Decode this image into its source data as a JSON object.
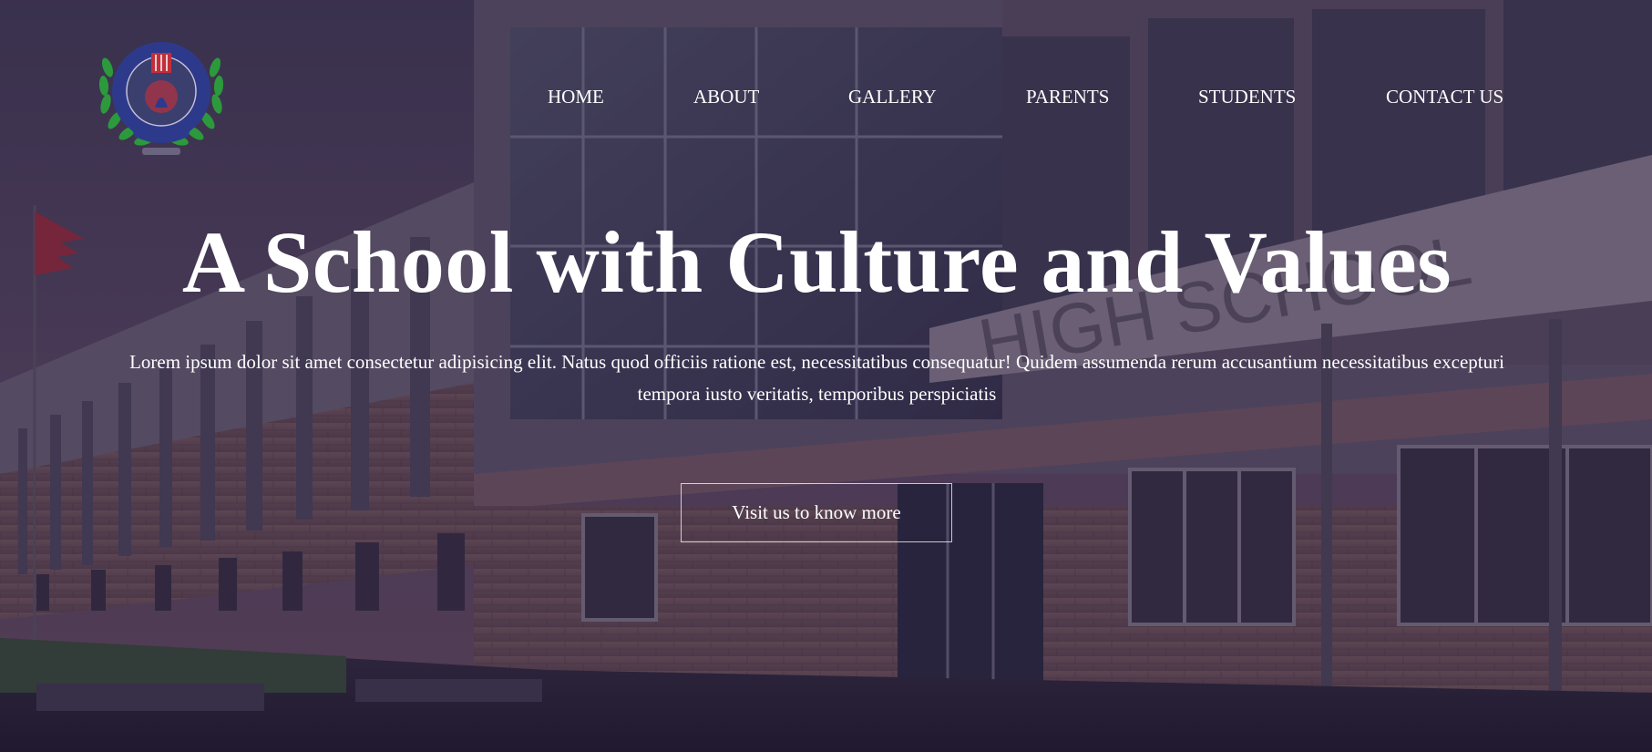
{
  "brand": {
    "logo_icon": "school-crest-logo-icon",
    "colors": {
      "crest_blue": "#2d3a8c",
      "crest_red": "#c0303a",
      "laurel_green": "#2c9a3c",
      "overlay": "#231937",
      "text": "#ffffff"
    }
  },
  "nav": {
    "items": [
      {
        "label": "HOME"
      },
      {
        "label": "ABOUT"
      },
      {
        "label": "GALLERY"
      },
      {
        "label": "PARENTS"
      },
      {
        "label": "STUDENTS"
      },
      {
        "label": "CONTACT US"
      }
    ]
  },
  "hero": {
    "background": "school-building-photo",
    "headline": "A School with Culture and Values",
    "lead": "Lorem ipsum dolor sit amet consectetur adipisicing elit. Natus quod officiis ratione est, necessitatibus consequatur! Quidem assumenda rerum accusantium necessitatibus excepturi tempora iusto veritatis, temporibus perspiciatis",
    "cta_label": "Visit us to know more"
  },
  "background_sign": "HIGH SCHOOL"
}
